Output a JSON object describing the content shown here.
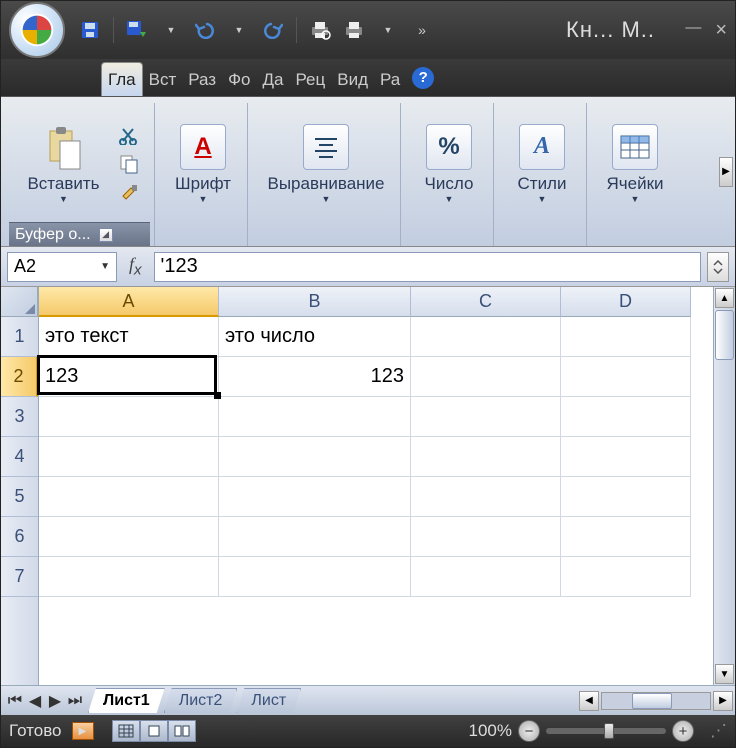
{
  "title": "Кн... М..",
  "qat_icons": [
    "save",
    "save-as",
    "undo",
    "redo",
    "print-preview",
    "quick-print",
    "more"
  ],
  "tabs": [
    "Гла",
    "Вст",
    "Раз",
    "Фо",
    "Да",
    "Рец",
    "Вид",
    "Ра"
  ],
  "active_tab": 0,
  "ribbon": {
    "clipboard": {
      "button": "Вставить",
      "label": "Буфер о..."
    },
    "font": {
      "label": "Шрифт"
    },
    "alignment": {
      "label": "Выравнивание"
    },
    "number": {
      "label": "Число"
    },
    "styles": {
      "label": "Стили"
    },
    "cells": {
      "label": "Ячейки"
    }
  },
  "namebox": "A2",
  "formula": "'123",
  "columns": [
    {
      "name": "A",
      "width": 180
    },
    {
      "name": "B",
      "width": 192
    },
    {
      "name": "C",
      "width": 150
    },
    {
      "name": "D",
      "width": 130
    }
  ],
  "rows": [
    1,
    2,
    3,
    4,
    5,
    6,
    7
  ],
  "active_cell": {
    "row": 2,
    "col": "A"
  },
  "cells": {
    "A1": "это текст",
    "B1": "это число",
    "A2": "123",
    "B2": "123"
  },
  "numeric_cells": [
    "B2"
  ],
  "sheets": [
    "Лист1",
    "Лист2",
    "Лист"
  ],
  "active_sheet": 0,
  "status": "Готово",
  "zoom": "100%"
}
